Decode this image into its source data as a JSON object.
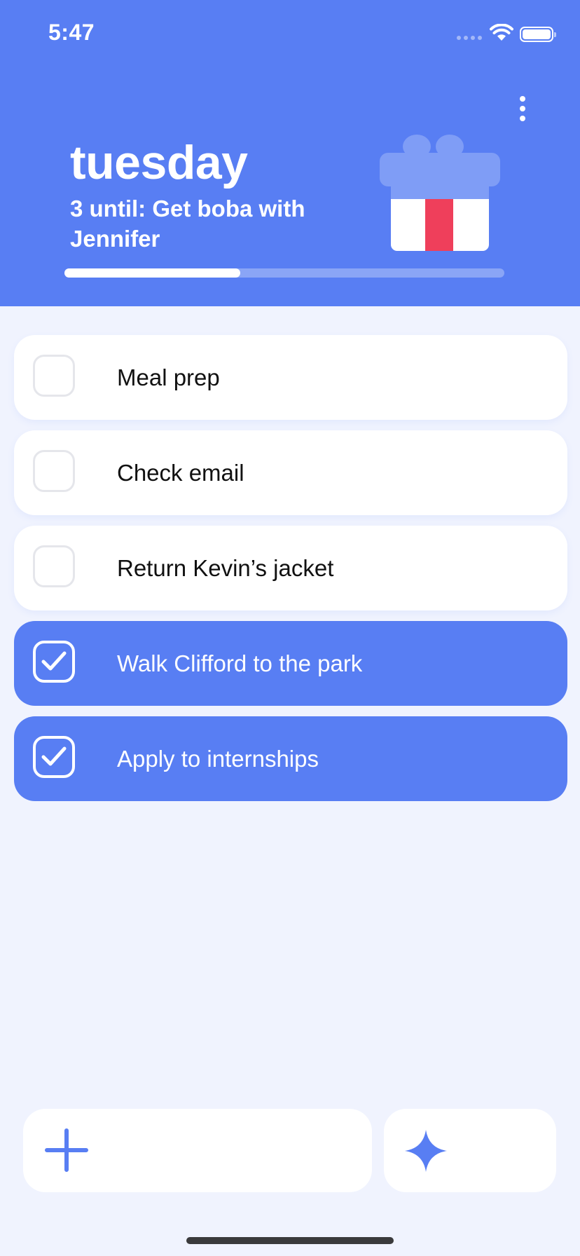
{
  "status_bar": {
    "time": "5:47"
  },
  "header": {
    "day": "tuesday",
    "countdown": "3 until: Get boba with Jennifer",
    "progress_fraction": 0.4,
    "more_icon": "vertical-ellipsis-icon",
    "gift_icon": "gift-icon"
  },
  "tasks": [
    {
      "label": "Meal prep",
      "done": false
    },
    {
      "label": "Check email",
      "done": false
    },
    {
      "label": "Return Kevin’s jacket",
      "done": false
    },
    {
      "label": "Walk Clifford to the park",
      "done": true
    },
    {
      "label": "Apply to internships",
      "done": true
    }
  ],
  "bottom_bar": {
    "add_icon": "plus-icon",
    "sparkle_icon": "sparkle-icon"
  },
  "colors": {
    "accent": "#587EF3",
    "background": "#F0F3FE",
    "gift_ribbon": "#EF3F5B"
  }
}
